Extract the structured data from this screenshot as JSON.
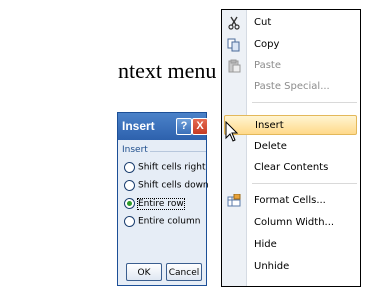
{
  "caption": "ntext menu",
  "dialog": {
    "title": "Insert",
    "help_glyph": "?",
    "close_glyph": "X",
    "group_label": "Insert",
    "options": [
      {
        "label": "Shift cells right",
        "selected": false
      },
      {
        "label": "Shift cells down",
        "selected": false
      },
      {
        "label": "Entire row",
        "selected": true
      },
      {
        "label": "Entire column",
        "selected": false
      }
    ],
    "ok_label": "OK",
    "cancel_label": "Cancel"
  },
  "context_menu": {
    "items": [
      {
        "label": "Cut",
        "icon": "scissors-icon",
        "enabled": true
      },
      {
        "label": "Copy",
        "icon": "copy-icon",
        "enabled": true
      },
      {
        "label": "Paste",
        "icon": "paste-icon",
        "enabled": false
      },
      {
        "label": "Paste Special...",
        "icon": null,
        "enabled": false
      },
      {
        "label": "Insert",
        "icon": null,
        "enabled": true,
        "highlighted": true
      },
      {
        "label": "Delete",
        "icon": null,
        "enabled": true
      },
      {
        "label": "Clear Contents",
        "icon": null,
        "enabled": true
      },
      {
        "label": "Format Cells...",
        "icon": "format-cells-icon",
        "enabled": true
      },
      {
        "label": "Column Width...",
        "icon": null,
        "enabled": true
      },
      {
        "label": "Hide",
        "icon": null,
        "enabled": true
      },
      {
        "label": "Unhide",
        "icon": null,
        "enabled": true
      }
    ]
  },
  "colors": {
    "title_bar": "#2d61ad",
    "highlight": "#ffd98a",
    "selected_radio": "#2d9a2a"
  }
}
